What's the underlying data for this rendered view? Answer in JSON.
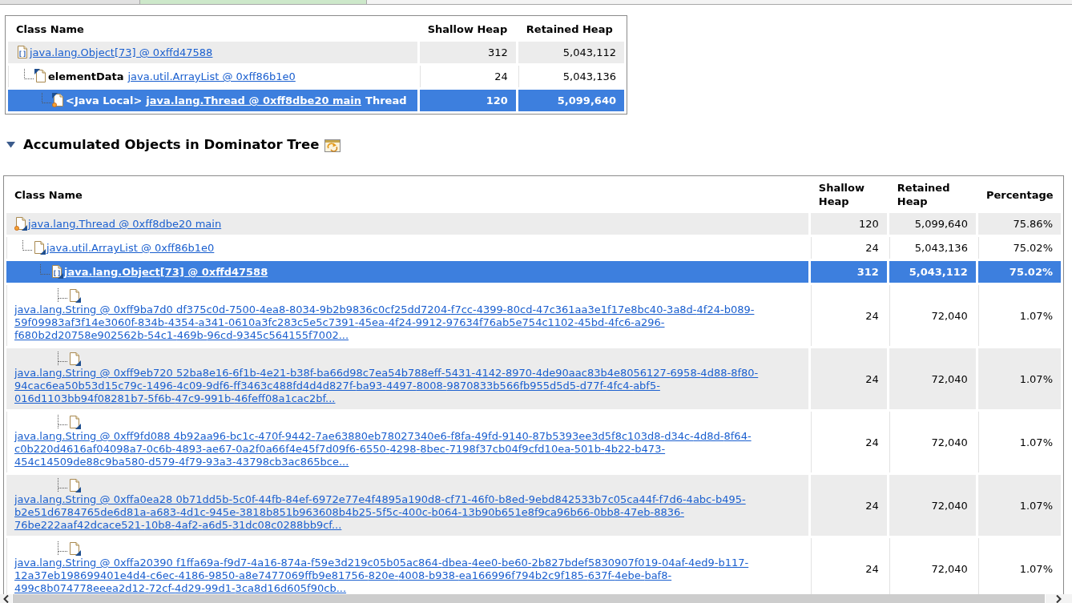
{
  "tab_strip": {
    "tabs": [
      {
        "selected": false
      },
      {
        "selected": true
      }
    ]
  },
  "path_table": {
    "columns": [
      "Class Name",
      "Shallow Heap",
      "Retained Heap"
    ],
    "rows": [
      {
        "kind": "array",
        "label": "java.lang.Object[73] @ 0xffd47588",
        "shallow_heap": "312",
        "retained_heap": "5,043,112",
        "selected": false,
        "children": [
          {
            "kind": "object",
            "prefix": "elementData",
            "label": "java.util.ArrayList @ 0xff86b1e0",
            "shallow_heap": "24",
            "retained_heap": "5,043,136",
            "selected": false,
            "children": [
              {
                "kind": "thread",
                "prefix": "<Java Local>",
                "label": "java.lang.Thread @ 0xff8dbe20 main",
                "suffix": "Thread",
                "shallow_heap": "120",
                "retained_heap": "5,099,640",
                "selected": true
              }
            ]
          }
        ]
      }
    ]
  },
  "section": {
    "title": "Accumulated Objects in Dominator Tree",
    "expanded": true
  },
  "dominator_table": {
    "columns": [
      "Class Name",
      "Shallow Heap",
      "Retained Heap",
      "Percentage"
    ],
    "rows": [
      {
        "kind": "thread",
        "label": "java.lang.Thread @ 0xff8dbe20 main",
        "shallow_heap": "120",
        "retained_heap": "5,099,640",
        "percentage": "75.86%",
        "selected": false,
        "children": [
          {
            "kind": "object",
            "label": "java.util.ArrayList @ 0xff86b1e0",
            "shallow_heap": "24",
            "retained_heap": "5,043,136",
            "percentage": "75.02%",
            "selected": false,
            "children": [
              {
                "kind": "array",
                "label": "java.lang.Object[73] @ 0xffd47588",
                "shallow_heap": "312",
                "retained_heap": "5,043,112",
                "percentage": "75.02%",
                "selected": true,
                "more_children_below": true,
                "children": [
                  {
                    "kind": "object",
                    "label": "java.lang.String @ 0xff9ba7d0 df375c0d-7500-4ea8-8034-9b2b9836c0cf25dd7204-f7cc-4399-80cd-47c361aa3e1f17e8bc40-3a8d-4f24-b089-59f09983af3f14e3060f-834b-4354-a341-0610a3fc283c5e5c7391-45ea-4f24-9912-97634f76ab5e754c1102-45bd-4fc6-a296-f680b2d20758e902562b-54c1-469b-96cd-9345c564155f7002...",
                    "shallow_heap": "24",
                    "retained_heap": "72,040",
                    "percentage": "1.07%",
                    "selected": false
                  },
                  {
                    "kind": "object",
                    "label": "java.lang.String @ 0xff9eb720 52ba8e16-6f1b-4e21-b38f-ba66d98c7ea54b788eff-5431-4142-8970-4de90aac83b4e8056127-6958-4d88-8f80-94cac6ea50b53d15c79c-1496-4c09-9df6-ff3463c488fd4d4d827f-ba93-4497-8008-9870833b566fb955d5d5-d77f-4fc4-abf5-016d1103bb94f08281b7-5f6b-47c9-991b-46feff08a1cac2bf...",
                    "shallow_heap": "24",
                    "retained_heap": "72,040",
                    "percentage": "1.07%",
                    "selected": false
                  },
                  {
                    "kind": "object",
                    "label": "java.lang.String @ 0xff9fd088 4b92aa96-bc1c-470f-9442-7ae63880eb78027340e6-f8fa-49fd-9140-87b5393ee3d5f8c103d8-d34c-4d8d-8f64-c0b220d4616af04098a7-0c6b-4893-ae67-0a2f0a66f4e45f7d09f6-6550-4298-8bec-7198f37cb04f9cfd10ea-501b-4b22-b473-454c14509de88c9ba580-d579-4f79-93a3-43798cb3ac865bce...",
                    "shallow_heap": "24",
                    "retained_heap": "72,040",
                    "percentage": "1.07%",
                    "selected": false
                  },
                  {
                    "kind": "object",
                    "label": "java.lang.String @ 0xffa0ea28 0b71dd5b-5c0f-44fb-84ef-6972e77e4f4895a190d8-cf71-46f0-b8ed-9ebd842533b7c05ca44f-f7d6-4abc-b495-b2e51d6784765de6d81a-a683-4d1c-945e-3818b851b963608b4b25-5f5c-400c-b064-13b90b651e8f9ca96b66-0bb8-47eb-8836-76be222aaf42dcace521-10b8-4af2-a6d5-31dc08c0288bb9cf...",
                    "shallow_heap": "24",
                    "retained_heap": "72,040",
                    "percentage": "1.07%",
                    "selected": false
                  },
                  {
                    "kind": "object",
                    "label": "java.lang.String @ 0xffa20390 f1ffa69a-f9d7-4a16-874a-f59e3d219c05b05ac864-dbea-4ee0-be60-2b827bdef5830907f019-04af-4ed9-b117-12a37eb198699401e4d4-c6ec-4186-9850-a8e7477069ffb9e81756-820e-4008-b938-ea166996f794b2c9f185-637f-4ebe-baf8-499c8b074778eeea2d12-72cf-4d29-99d1-3ca8d16d605f90cb...",
                    "shallow_heap": "24",
                    "retained_heap": "72,040",
                    "percentage": "1.07%",
                    "selected": false
                  }
                ]
              }
            ]
          }
        ]
      }
    ]
  }
}
